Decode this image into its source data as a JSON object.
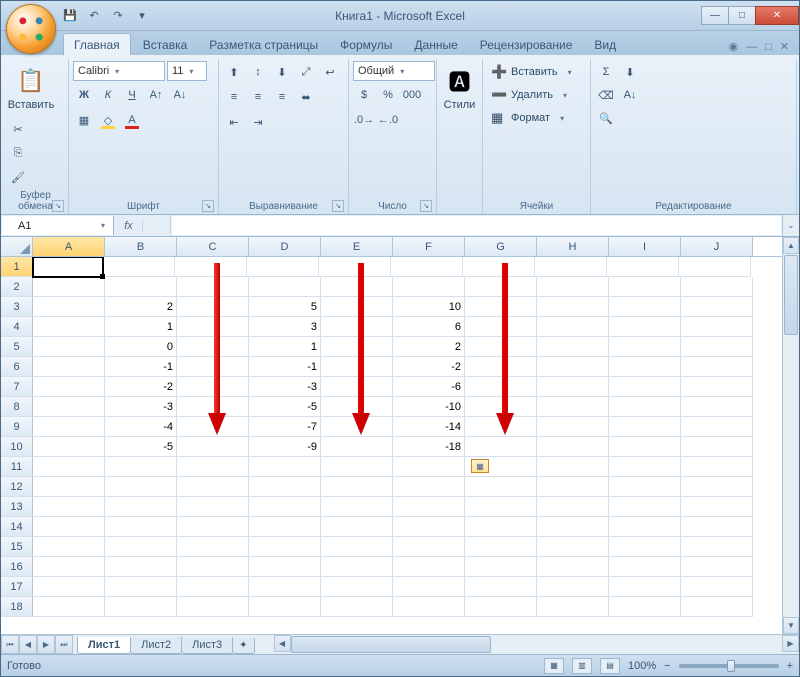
{
  "title": "Книга1 - Microsoft Excel",
  "tabs": [
    "Главная",
    "Вставка",
    "Разметка страницы",
    "Формулы",
    "Данные",
    "Рецензирование",
    "Вид"
  ],
  "active_tab": 0,
  "groups": {
    "clipboard": {
      "label": "Буфер обмена",
      "paste": "Вставить"
    },
    "font": {
      "label": "Шрифт",
      "name": "Calibri",
      "size": "11"
    },
    "align": {
      "label": "Выравнивание"
    },
    "number": {
      "label": "Число",
      "format": "Общий"
    },
    "styles": {
      "label": "Стили"
    },
    "cells": {
      "label": "Ячейки",
      "insert": "Вставить",
      "delete": "Удалить",
      "format": "Формат"
    },
    "editing": {
      "label": "Редактирование"
    }
  },
  "namebox": "A1",
  "columns": [
    "A",
    "B",
    "C",
    "D",
    "E",
    "F",
    "G",
    "H",
    "I",
    "J"
  ],
  "row_count": 18,
  "selected": {
    "row": 1,
    "col": 0
  },
  "cells": {
    "r3c1": "2",
    "r3c3": "5",
    "r3c5": "10",
    "r4c1": "1",
    "r4c3": "3",
    "r4c5": "6",
    "r5c1": "0",
    "r5c3": "1",
    "r5c5": "2",
    "r6c1": "-1",
    "r6c3": "-1",
    "r6c5": "-2",
    "r7c1": "-2",
    "r7c3": "-3",
    "r7c5": "-6",
    "r8c1": "-3",
    "r8c3": "-5",
    "r8c5": "-10",
    "r9c1": "-4",
    "r9c3": "-7",
    "r9c5": "-14",
    "r10c1": "-5",
    "r10c3": "-9",
    "r10c5": "-18"
  },
  "sheets": [
    "Лист1",
    "Лист2",
    "Лист3"
  ],
  "active_sheet": 0,
  "status": "Готово",
  "zoom": "100%"
}
